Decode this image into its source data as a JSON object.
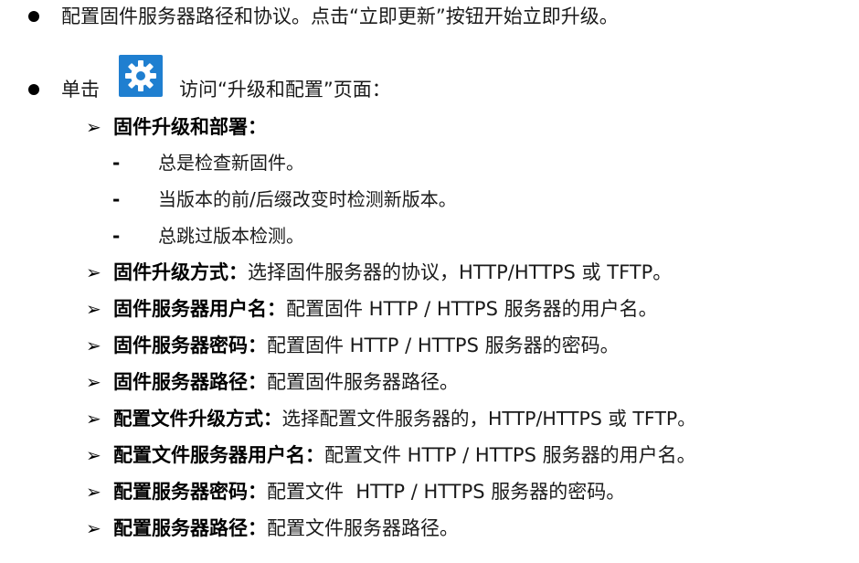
{
  "items": {
    "line1": "配置固件服务器路径和协议。点击“立即更新”按钮开始立即升级。",
    "line2_prefix": "单击",
    "line2_suffix": "访问“升级和配置”页面：",
    "sub_heading": "固件升级和部署：",
    "sub_heading_options": [
      "总是检查新固件。",
      "当版本的前/后缀改变时检测新版本。",
      "总跳过版本检测。"
    ],
    "settings": [
      {
        "label": "固件升级方式：",
        "desc": "选择固件服务器的协议，HTTP/HTTPS 或 TFTP。"
      },
      {
        "label": "固件服务器用户名：",
        "desc": "配置固件 HTTP / HTTPS 服务器的用户名。"
      },
      {
        "label": "固件服务器密码：",
        "desc": "配置固件 HTTP / HTTPS 服务器的密码。"
      },
      {
        "label": "固件服务器路径：",
        "desc": "配置固件服务器路径。"
      },
      {
        "label": "配置文件升级方式：",
        "desc": "选择配置文件服务器的，HTTP/HTTPS 或 TFTP。"
      },
      {
        "label": "配置文件服务器用户名：",
        "desc": "配置文件 HTTP / HTTPS 服务器的用户名。"
      },
      {
        "label": "配置服务器密码：",
        "desc": "配置文件  HTTP / HTTPS 服务器的密码。"
      },
      {
        "label": "配置服务器路径：",
        "desc": "配置文件服务器路径。"
      }
    ]
  },
  "icons": {
    "bullet": "filled-circle",
    "arrow": "arrowhead",
    "settings_icon": "gear-icon"
  },
  "colors": {
    "gear_bg": "#1f7fd0",
    "text": "#1a1a1a"
  }
}
